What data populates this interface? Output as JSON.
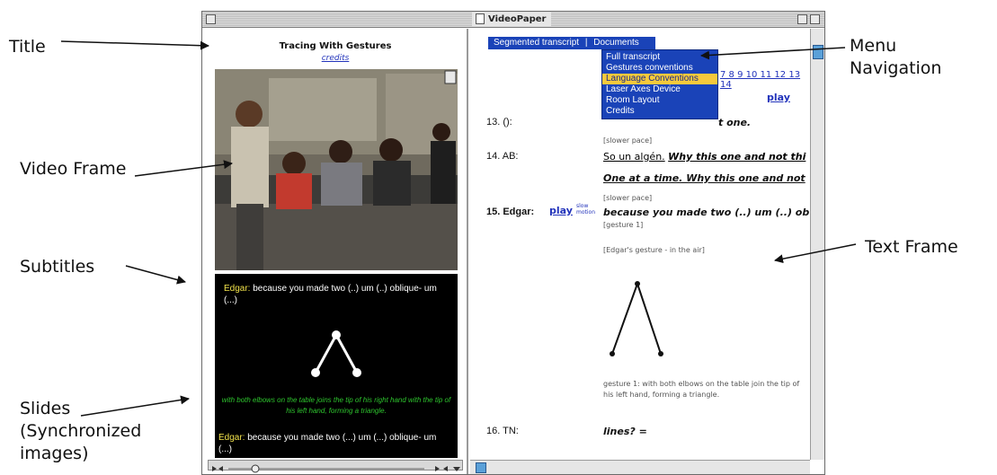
{
  "annotations": {
    "title": "Title",
    "video_frame": "Video Frame",
    "subtitles": "Subtitles",
    "slides": "Slides (Synchronized images)",
    "menu_navigation": "Menu Navigation",
    "text_frame": "Text Frame"
  },
  "window": {
    "title": "VideoPaper"
  },
  "left_pane": {
    "video_title": "Tracing With Gestures",
    "credits_link": "credits",
    "subtitle_speaker": "Edgar:",
    "subtitle_text": "because you made two (..) um (..) oblique- um (...)",
    "slide_caption": "with both elbows on the table joins the tip of his right hand with the tip of his left hand, forming a triangle.",
    "slide_speaker": "Edgar:",
    "slide_text": "because you made two (...) um (...) oblique- um (...)"
  },
  "right_pane": {
    "nav": {
      "segmented_transcript": "Segmented transcript",
      "separator": "|",
      "documents": "Documents"
    },
    "dropdown": [
      {
        "label": "Full transcript"
      },
      {
        "label": "Gestures conventions"
      },
      {
        "label": "Language Conventions"
      },
      {
        "label": "Laser Axes Device"
      },
      {
        "label": "Room Layout"
      },
      {
        "label": "Credits"
      }
    ],
    "page_numbers_visible": "7 8 9 10 11 12 13 14",
    "play_top": "play",
    "row13": {
      "num": "13. ():",
      "text_visible": "t one."
    },
    "row14": {
      "note": "[slower pace]",
      "num": "14. AB:",
      "text1_prefix": "So un algén.",
      "text1_italic": "Why this one and not thi",
      "text2": "One at a time. Why this one and not"
    },
    "row15": {
      "note": "[slower pace]",
      "num": "15. Edgar:",
      "play": "play",
      "slow_motion": "slow motion",
      "text": "because you made two (..) um (..) obli",
      "gesture_tag": "[gesture 1]",
      "gesture_note": "[Edgar's gesture - in the air]",
      "gesture_caption": "gesture 1: with both elbows on the table join the tip of his left hand, forming a triangle."
    },
    "row16": {
      "num": "16. TN:",
      "text": "lines? ="
    }
  }
}
